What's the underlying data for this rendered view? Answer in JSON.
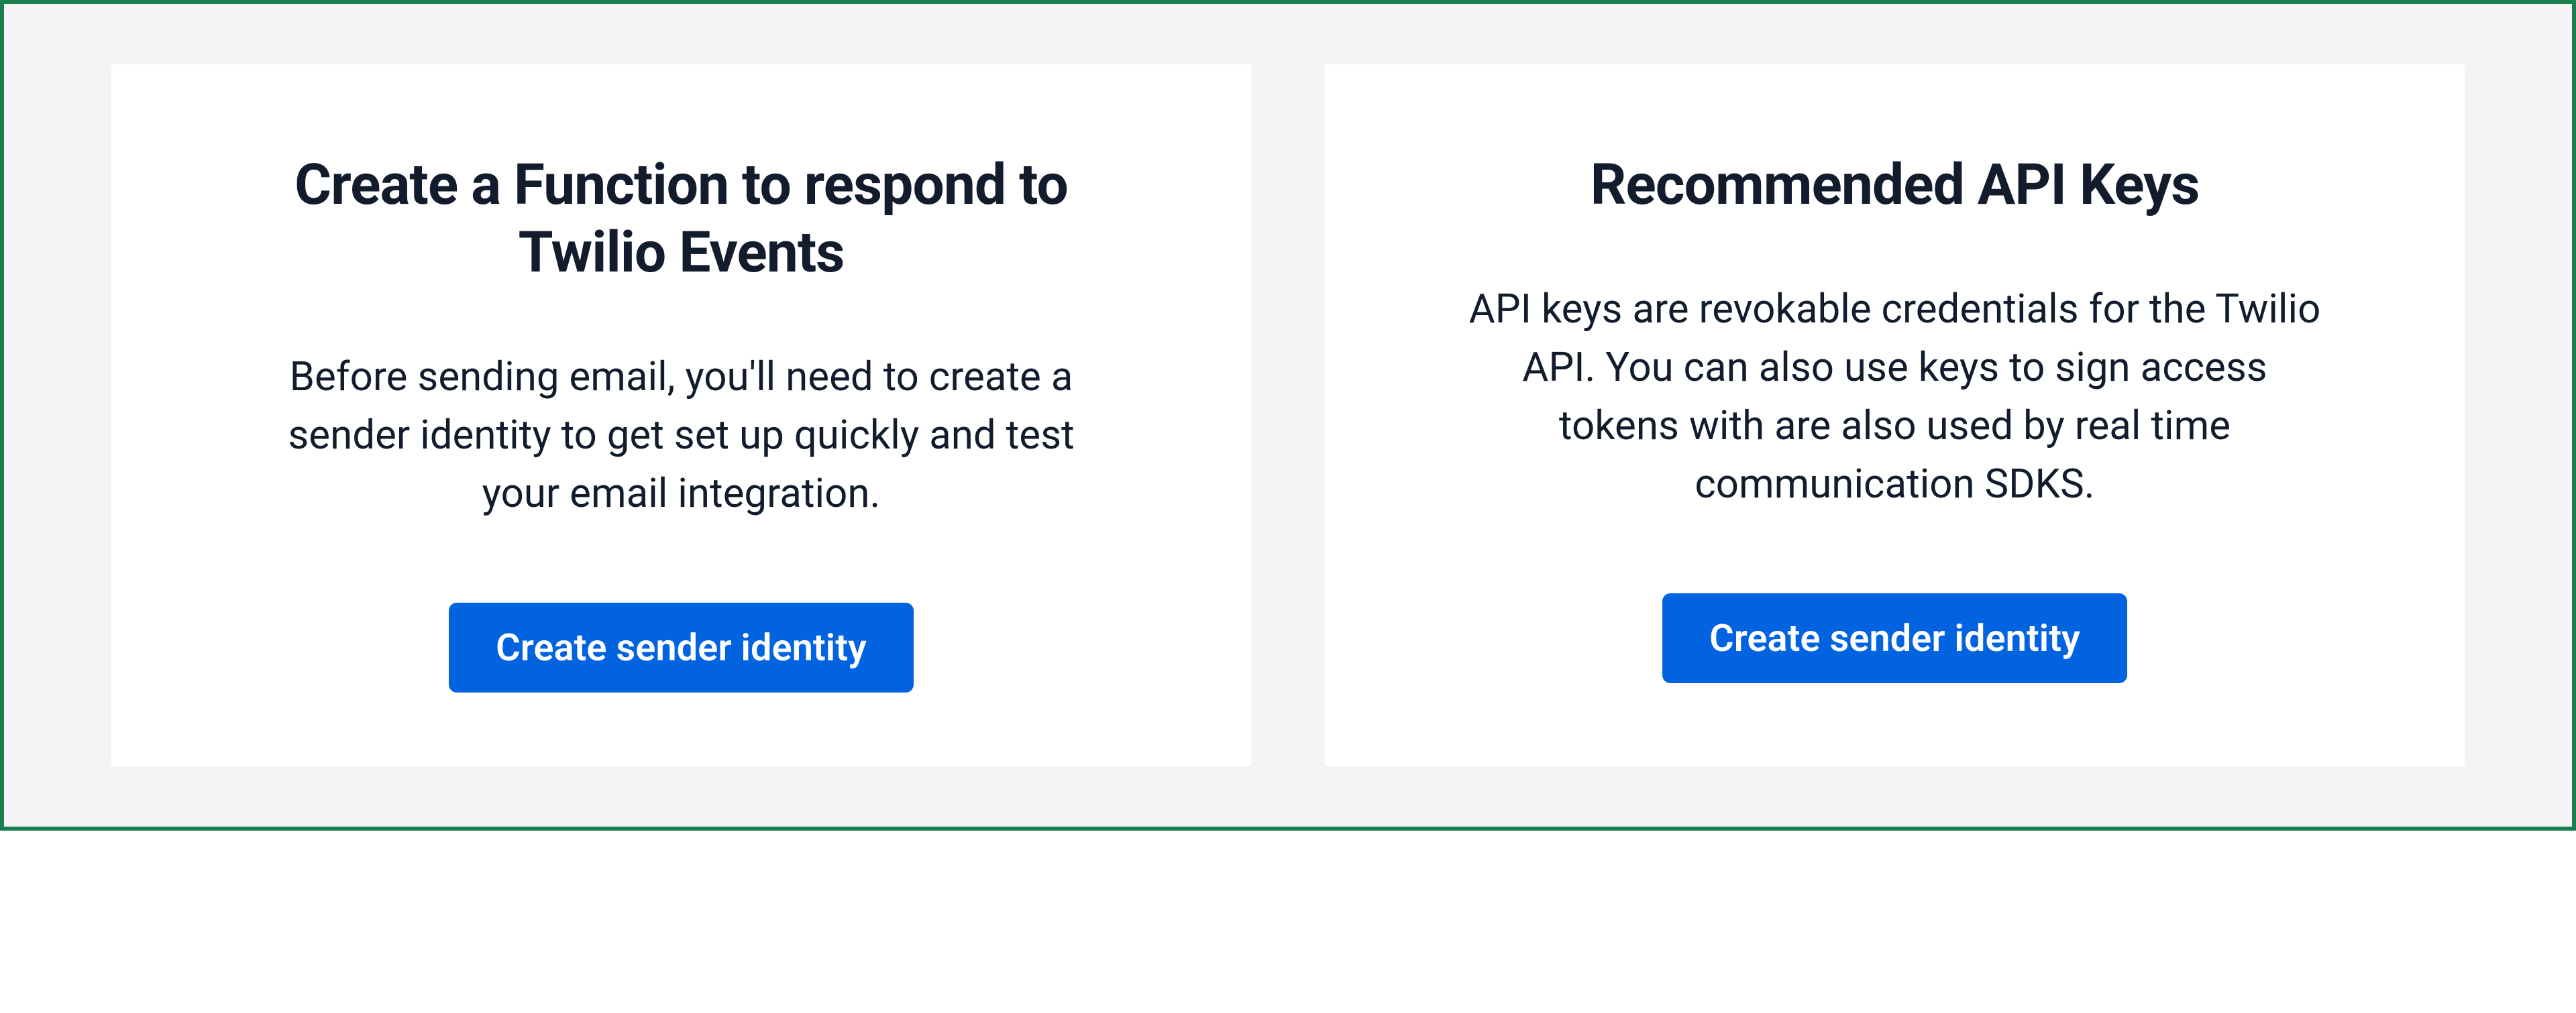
{
  "colors": {
    "frame_border": "#1a7f4e",
    "page_bg": "#f4f4f6",
    "card_bg": "#ffffff",
    "text": "#121c2d",
    "button_bg": "#0263e0",
    "button_text": "#ffffff"
  },
  "cards": [
    {
      "title": "Create a Function to respond to Twilio Events",
      "description": "Before sending email, you'll need to create a sender identity to get set up quickly and test your email integration.",
      "button_label": "Create sender identity"
    },
    {
      "title": "Recommended API Keys",
      "description": "API keys are revokable credentials for the Twilio API. You can also use keys to sign access tokens with are also used by real time communication SDKS.",
      "button_label": "Create sender identity"
    }
  ]
}
